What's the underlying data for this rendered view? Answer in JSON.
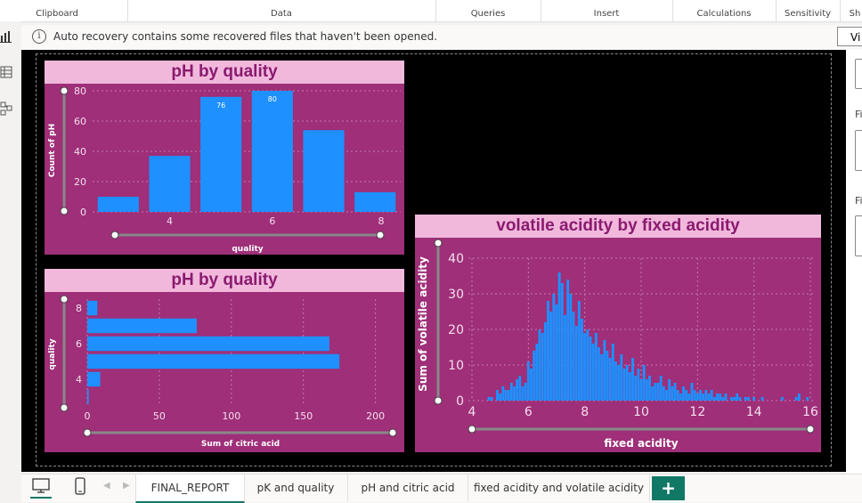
{
  "ribbon": {
    "groups": [
      {
        "label": "Clipboard"
      },
      {
        "label": "Data"
      },
      {
        "label": "Queries"
      },
      {
        "label": "Insert"
      },
      {
        "label": "Calculations"
      },
      {
        "label": "Sensitivity"
      },
      {
        "label": "Sh"
      }
    ]
  },
  "infobar": {
    "icon": "info-icon",
    "message": "Auto recovery contains some recovered files that haven't been opened.",
    "view_button": "Vi"
  },
  "rightpane": {
    "label1": "Fi",
    "label2": "Fi"
  },
  "charts": {
    "top_left": {
      "title": "pH by quality",
      "xlabel": "quality",
      "ylabel": "Count of pH",
      "yticks": [
        "0",
        "20",
        "40",
        "60",
        "80"
      ],
      "xticks": [
        "4",
        "6",
        "8"
      ],
      "labels": [
        "76",
        "80"
      ]
    },
    "bottom_left": {
      "title": "pH by quality",
      "xlabel": "Sum of citric acid",
      "ylabel": "quality",
      "yticks": [
        "4",
        "6",
        "8"
      ],
      "xticks": [
        "0",
        "50",
        "100",
        "150",
        "200"
      ]
    },
    "right": {
      "title": "volatile acidity by fixed acidity",
      "xlabel": "fixed acidity",
      "ylabel": "Sum of volatile acidity",
      "yticks": [
        "0",
        "10",
        "20",
        "30",
        "40"
      ],
      "xticks": [
        "4",
        "6",
        "8",
        "10",
        "12",
        "14",
        "16"
      ]
    }
  },
  "chart_data": [
    {
      "type": "bar",
      "title": "pH by quality",
      "xlabel": "quality",
      "ylabel": "Count of pH",
      "categories": [
        3,
        4,
        5,
        6,
        7,
        8
      ],
      "values": [
        10,
        37,
        76,
        80,
        54,
        13
      ],
      "ylim": [
        0,
        80
      ],
      "grid": true
    },
    {
      "type": "bar",
      "orientation": "horizontal",
      "title": "pH by quality",
      "xlabel": "Sum of citric acid",
      "ylabel": "quality",
      "categories": [
        3,
        4,
        5,
        6,
        7,
        8
      ],
      "values": [
        1,
        9,
        175,
        168,
        76,
        7
      ],
      "xlim": [
        0,
        200
      ],
      "grid": true
    },
    {
      "type": "bar",
      "title": "volatile acidity by fixed acidity",
      "xlabel": "fixed acidity",
      "ylabel": "Sum of volatile acidity",
      "xlim": [
        4,
        16
      ],
      "ylim": [
        0,
        40
      ],
      "grid": true,
      "x": [
        4.6,
        4.7,
        4.9,
        5.0,
        5.1,
        5.2,
        5.3,
        5.4,
        5.5,
        5.6,
        5.7,
        5.8,
        5.9,
        6.0,
        6.1,
        6.2,
        6.3,
        6.4,
        6.5,
        6.6,
        6.7,
        6.8,
        6.9,
        7.0,
        7.1,
        7.2,
        7.3,
        7.4,
        7.5,
        7.6,
        7.7,
        7.8,
        7.9,
        8.0,
        8.1,
        8.2,
        8.3,
        8.4,
        8.5,
        8.6,
        8.7,
        8.8,
        8.9,
        9.0,
        9.1,
        9.2,
        9.3,
        9.4,
        9.5,
        9.6,
        9.7,
        9.8,
        9.9,
        10.0,
        10.1,
        10.2,
        10.3,
        10.4,
        10.5,
        10.6,
        10.7,
        10.8,
        10.9,
        11.0,
        11.1,
        11.2,
        11.3,
        11.4,
        11.5,
        11.6,
        11.7,
        11.8,
        11.9,
        12.0,
        12.1,
        12.2,
        12.3,
        12.4,
        12.5,
        12.6,
        12.7,
        12.8,
        12.9,
        13.0,
        13.2,
        13.3,
        13.4,
        13.5,
        13.7,
        13.8,
        14.0,
        14.3,
        15.0,
        15.5,
        15.6,
        15.9
      ],
      "values": [
        1,
        1,
        3,
        2,
        4,
        3,
        3,
        5,
        4,
        6,
        7,
        4,
        5,
        11,
        9,
        14,
        16,
        20,
        19,
        22,
        28,
        25,
        30,
        27,
        36,
        33,
        24,
        34,
        30,
        25,
        21,
        28,
        23,
        19,
        20,
        18,
        16,
        19,
        15,
        13,
        17,
        14,
        12,
        16,
        11,
        10,
        13,
        9,
        10,
        8,
        12,
        7,
        9,
        6,
        10,
        6,
        7,
        4,
        5,
        5,
        7,
        4,
        3,
        6,
        4,
        5,
        3,
        2,
        4,
        3,
        2,
        5,
        3,
        2,
        3,
        2,
        3,
        2,
        3,
        1,
        2,
        2,
        1,
        2,
        1,
        1,
        2,
        1,
        1,
        1,
        1,
        1,
        1,
        1,
        2,
        1
      ]
    }
  ]
}
